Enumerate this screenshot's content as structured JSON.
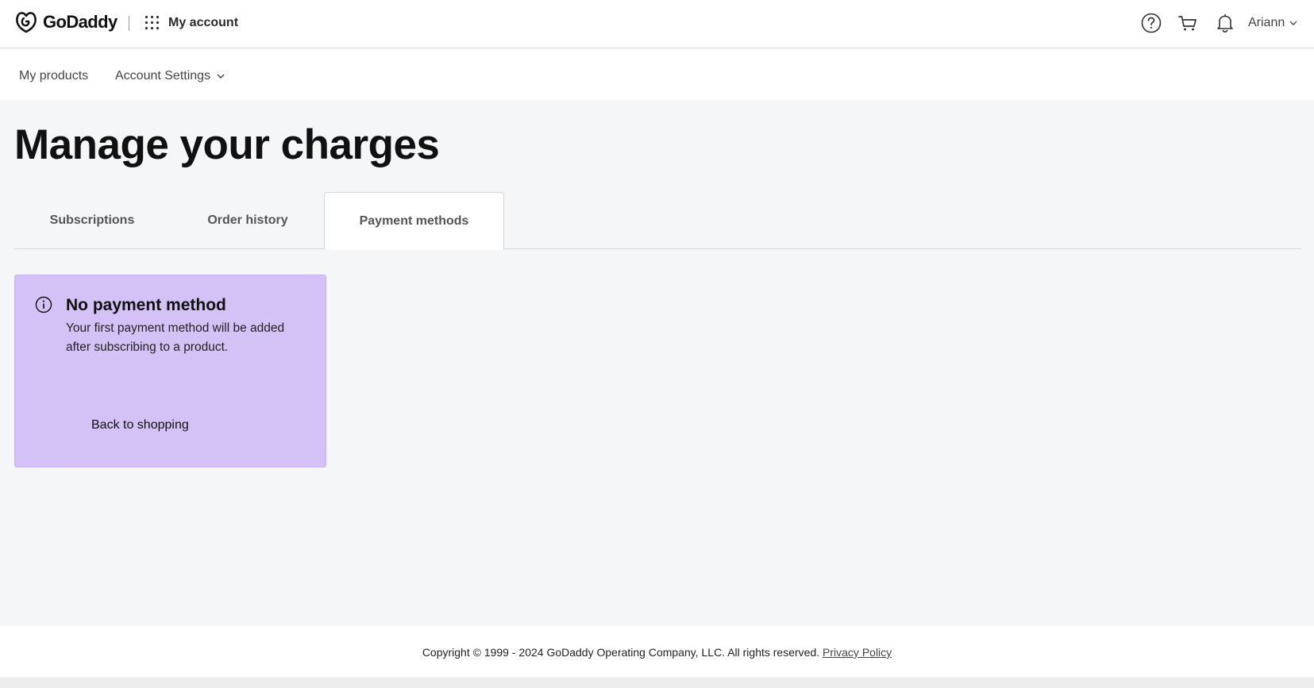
{
  "header": {
    "brand": "GoDaddy",
    "app_title": "My account",
    "user_name": "Ariann"
  },
  "subnav": {
    "products": "My products",
    "settings": "Account Settings"
  },
  "main": {
    "title": "Manage your charges",
    "tabs": [
      {
        "label": "Subscriptions"
      },
      {
        "label": "Order history"
      },
      {
        "label": "Payment methods",
        "active": true
      }
    ],
    "card": {
      "title": "No payment method",
      "text": "Your first payment method will be added after subscribing to a product.",
      "button": "Back to shopping",
      "background": "#d4c1f5"
    }
  },
  "footer": {
    "copyright": "Copyright © 1999 - 2024 GoDaddy Operating Company, LLC. All rights reserved.",
    "privacy_link": "Privacy Policy"
  },
  "icons": [
    "godaddy-logo",
    "apps-grid-icon",
    "help-icon",
    "cart-icon",
    "bell-icon",
    "chevron-down-icon",
    "info-icon"
  ]
}
